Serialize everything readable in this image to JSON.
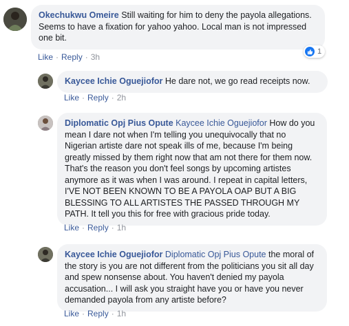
{
  "actions": {
    "like": "Like",
    "reply": "Reply",
    "separator": "·"
  },
  "comments": [
    {
      "author": "Okechukwu Omeire",
      "mention": "",
      "text": "Still waiting for him to deny the payola allegations. Seems to have a fixation for yahoo yahoo. Local man is not impressed one bit.",
      "time": "3h",
      "reaction_count": "1",
      "reaction_icon": "thumbs-up-icon"
    },
    {
      "author": "Kaycee Ichie Oguejiofor",
      "mention": "",
      "text": "He dare not, we go read receipts now.",
      "time": "2h"
    },
    {
      "author": "Diplomatic Opj Pius Opute",
      "mention": "Kaycee Ichie Oguejiofor",
      "text": "How do you mean I dare not when I'm telling you unequivocally that no Nigerian artiste dare not speak ills of me, because I'm being greatly missed by them right now that am not there for them now. That's the reason you don't feel songs by upcoming artistes anymore as it was when I was around. I repeat in capital letters, I'VE NOT BEEN KNOWN TO BE A PAYOLA OAP BUT A BIG BLESSING TO ALL ARTISTES THE PASSED THROUGH MY PATH. It tell you this for free with gracious pride today.",
      "time": "1h"
    },
    {
      "author": "Kaycee Ichie Oguejiofor",
      "mention": "Diplomatic Opj Pius Opute",
      "text": "the moral of the story is you are not different from the politicians you sit all day and spew nonsense about. You haven't denied my payola accusation... I will ask you straight have you or have you never demanded payola from any artiste before?",
      "time": "1h"
    }
  ],
  "colors": {
    "link": "#385898",
    "bubble": "#f2f3f5",
    "meta": "#90949c",
    "like_blue": "#1877f2"
  }
}
